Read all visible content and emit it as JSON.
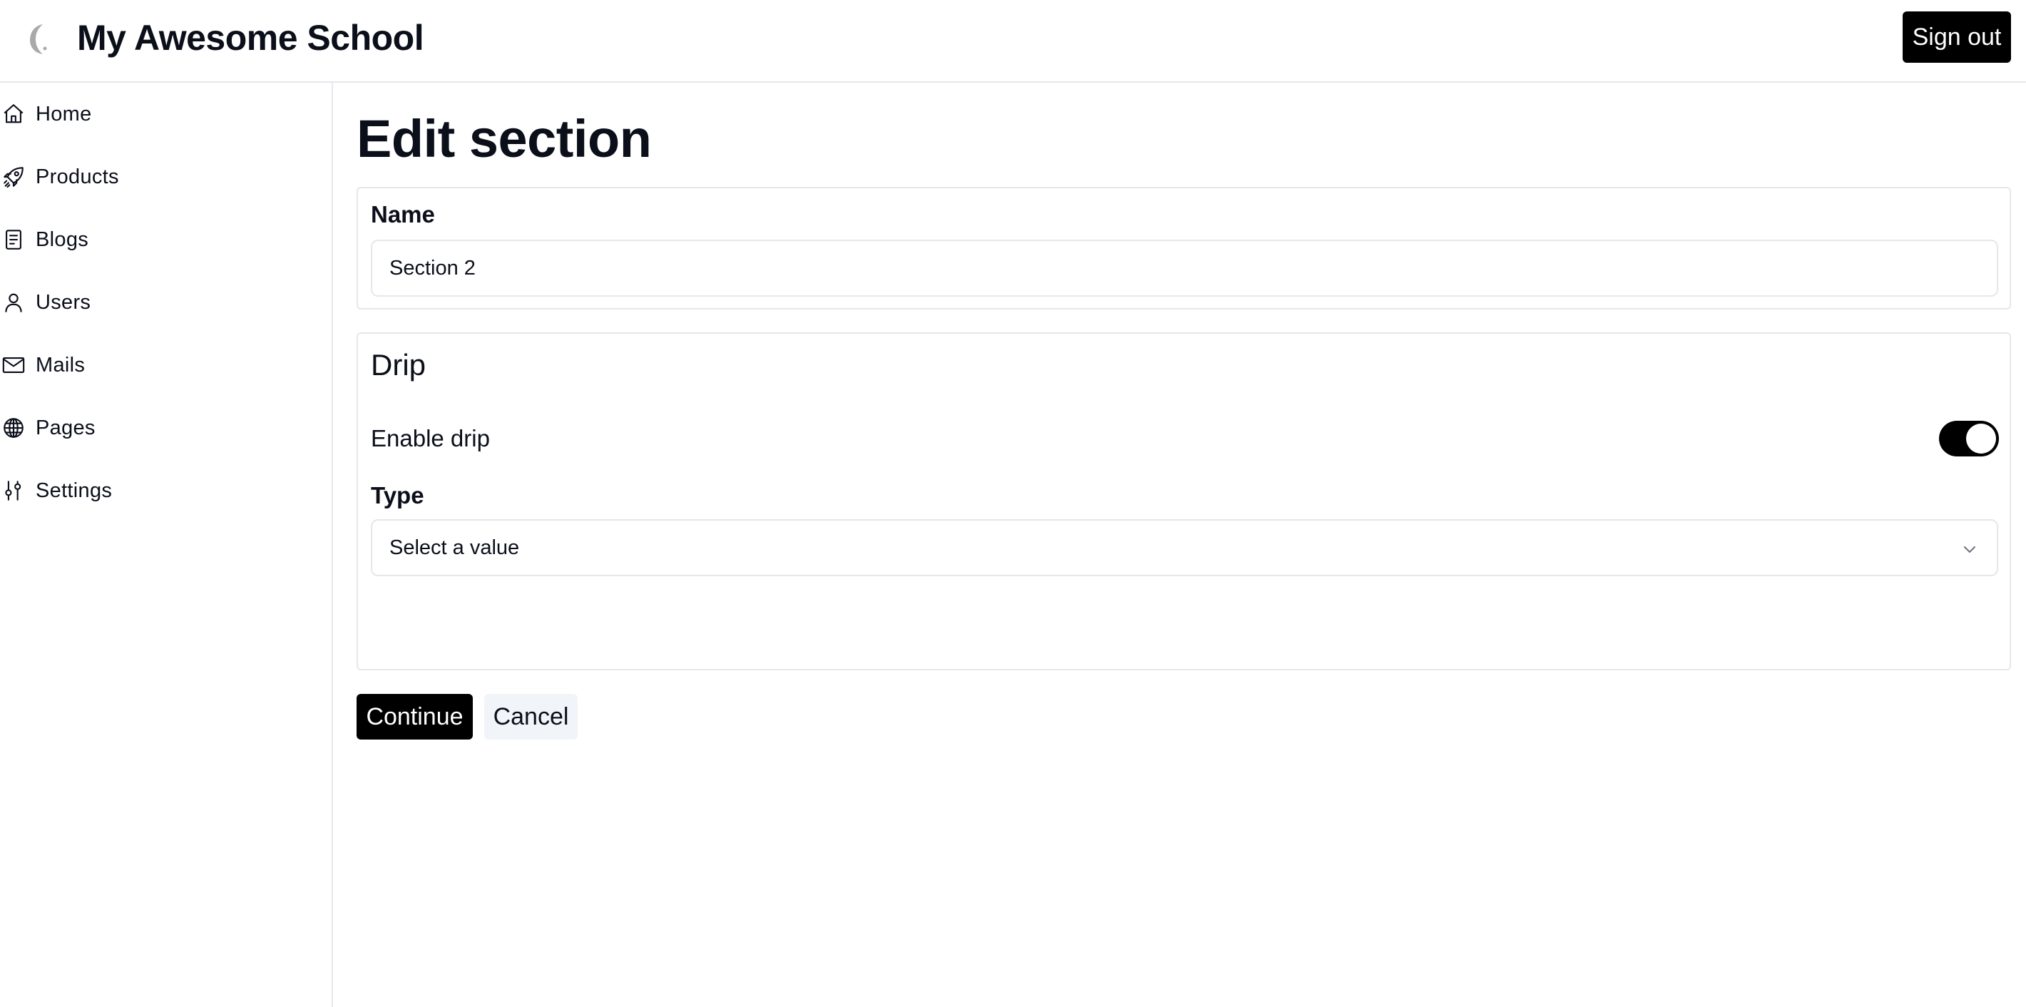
{
  "header": {
    "app_title": "My Awesome School",
    "logo_icon": "crescent-logo-icon",
    "sign_out_label": "Sign out"
  },
  "sidebar": {
    "items": [
      {
        "label": "Home",
        "icon": "home-icon"
      },
      {
        "label": "Products",
        "icon": "rocket-icon"
      },
      {
        "label": "Blogs",
        "icon": "document-icon"
      },
      {
        "label": "Users",
        "icon": "user-icon"
      },
      {
        "label": "Mails",
        "icon": "envelope-icon"
      },
      {
        "label": "Pages",
        "icon": "globe-icon"
      },
      {
        "label": "Settings",
        "icon": "sliders-icon"
      }
    ]
  },
  "main": {
    "page_title": "Edit section",
    "name_field": {
      "label": "Name",
      "value": "Section 2"
    },
    "drip": {
      "title": "Drip",
      "enable_label": "Enable drip",
      "enabled": true,
      "type_label": "Type",
      "type_value": "Select a value",
      "type_icon": "chevron-down-icon"
    },
    "actions": {
      "continue_label": "Continue",
      "cancel_label": "Cancel"
    }
  },
  "colors": {
    "primary_button": "#000000",
    "secondary_button": "#f1f4f8",
    "border": "#e5e7eb",
    "text": "#0b0f1a"
  }
}
